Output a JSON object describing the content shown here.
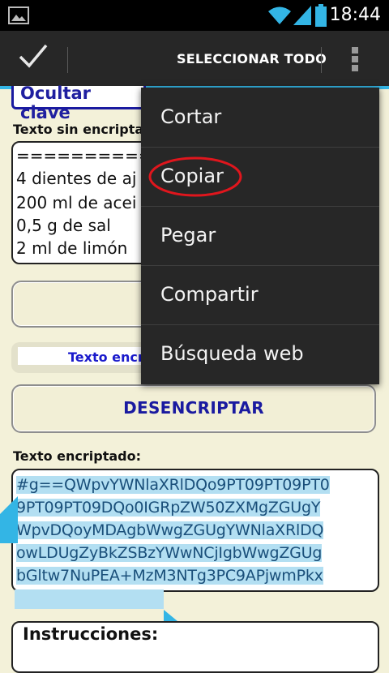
{
  "status_bar": {
    "time": "18:44"
  },
  "action_bar": {
    "select_all_label": "SELECCIONAR TODO"
  },
  "content": {
    "hide_key_label": "Ocultar clave",
    "plain_label": "Texto sin encriptar",
    "plain_lines": [
      "==============",
      "4 dientes de aj",
      "200 ml de acei",
      "0,5 g de sal",
      "2 ml de limón"
    ],
    "toggle_label": "Texto encr",
    "decrypt_label": "DESENCRIPTAR",
    "encrypted_label": "Texto encriptado:",
    "encrypted_lines": [
      "#g==QWpvYWNlaXRlDQo9PT09PT09PT0",
      "9PT09PT09DQo0IGRpZW50ZXMgZGUgY",
      "WpvDQoyMDAgbWwgZGUgYWNlaXRlDQ",
      "owLDUgZyBkZSBzYWwNCjIgbWwgZGUg",
      "bGltw7NuPEA+MzM3NTg3PC9APjwmPkx"
    ],
    "instructions_label": "Instrucciones:"
  },
  "menu": {
    "items": [
      "Cortar",
      "Copiar",
      "Pegar",
      "Compartir",
      "Búsqueda web"
    ]
  },
  "colors": {
    "accent": "#33b5e5",
    "annotation_circle": "#e0161d",
    "selection": "#b3dff2",
    "link_blue": "#1a1aa0"
  }
}
